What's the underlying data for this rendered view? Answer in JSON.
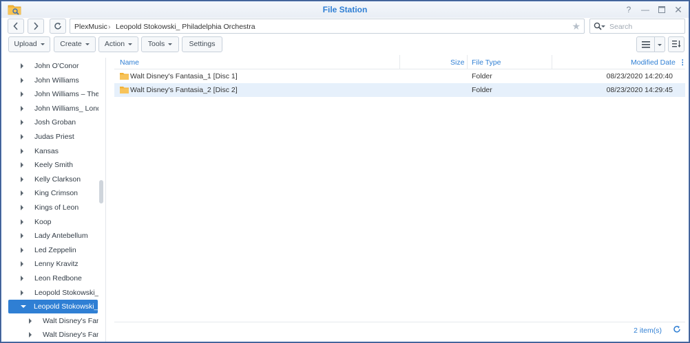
{
  "window": {
    "title": "File Station"
  },
  "nav": {
    "path": [
      "PlexMusic",
      "Leopold Stokowski_ Philadelphia Orchestra"
    ],
    "search_placeholder": "Search"
  },
  "toolbar": {
    "upload": "Upload",
    "create": "Create",
    "action": "Action",
    "tools": "Tools",
    "settings": "Settings"
  },
  "sidebar": {
    "items": [
      {
        "label": "John O'Conor",
        "level": 0,
        "selected": false
      },
      {
        "label": "John Williams",
        "level": 0,
        "selected": false
      },
      {
        "label": "John Williams – The",
        "level": 0,
        "selected": false
      },
      {
        "label": "John Williams_ Lond",
        "level": 0,
        "selected": false
      },
      {
        "label": "Josh Groban",
        "level": 0,
        "selected": false
      },
      {
        "label": "Judas Priest",
        "level": 0,
        "selected": false
      },
      {
        "label": "Kansas",
        "level": 0,
        "selected": false
      },
      {
        "label": "Keely Smith",
        "level": 0,
        "selected": false
      },
      {
        "label": "Kelly Clarkson",
        "level": 0,
        "selected": false
      },
      {
        "label": "King Crimson",
        "level": 0,
        "selected": false
      },
      {
        "label": "Kings of Leon",
        "level": 0,
        "selected": false
      },
      {
        "label": "Koop",
        "level": 0,
        "selected": false
      },
      {
        "label": "Lady Antebellum",
        "level": 0,
        "selected": false
      },
      {
        "label": "Led Zeppelin",
        "level": 0,
        "selected": false
      },
      {
        "label": "Lenny Kravitz",
        "level": 0,
        "selected": false
      },
      {
        "label": "Leon Redbone",
        "level": 0,
        "selected": false
      },
      {
        "label": "Leopold Stokowski_ B",
        "level": 0,
        "selected": false
      },
      {
        "label": "Leopold Stokowski_",
        "level": 0,
        "selected": true
      },
      {
        "label": "Walt Disney's Fant",
        "level": 1,
        "selected": false
      },
      {
        "label": "Walt Disney's Fant",
        "level": 1,
        "selected": false
      }
    ]
  },
  "table": {
    "headers": {
      "name": "Name",
      "size": "Size",
      "type": "File Type",
      "modified": "Modified Date"
    },
    "rows": [
      {
        "name": "Walt Disney's Fantasia_1 [Disc 1]",
        "size": "",
        "type": "Folder",
        "modified": "08/23/2020 14:20:40",
        "selected": false
      },
      {
        "name": "Walt Disney's Fantasia_2 [Disc 2]",
        "size": "",
        "type": "Folder",
        "modified": "08/23/2020 14:29:45",
        "selected": true
      }
    ]
  },
  "status": {
    "count": "2 item(s)"
  },
  "colors": {
    "accent": "#2f7fd4",
    "selected_row": "#e6f0fb",
    "folder": "#f2b134"
  }
}
